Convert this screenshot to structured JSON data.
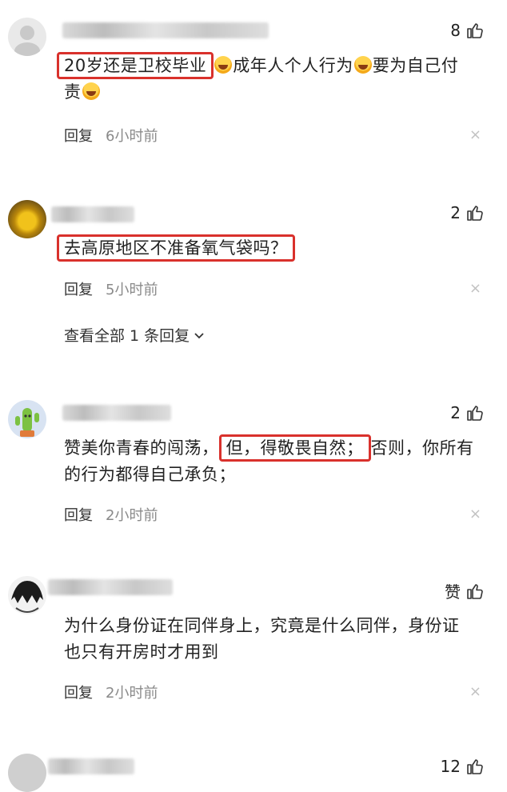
{
  "comments": [
    {
      "likes": "8",
      "segments": {
        "highlight": "20岁还是卫校毕业",
        "rest1": "成年人个人行为",
        "rest2": "要为自己付",
        "rest3": "责"
      },
      "reply": "回复",
      "time": "6小时前",
      "close": "×"
    },
    {
      "likes": "2",
      "segments": {
        "highlight": "去高原地区不准备氧气袋吗？"
      },
      "reply": "回复",
      "time": "5小时前",
      "close": "×",
      "view_all": "查看全部 1 条回复"
    },
    {
      "likes": "2",
      "segments": {
        "before": "赞美你青春的闯荡，",
        "highlight": "但，得敬畏自然；",
        "after": "否则，你所有",
        "line2": "的行为都得自己承负；"
      },
      "reply": "回复",
      "time": "2小时前",
      "close": "×"
    },
    {
      "likes": "赞",
      "segments": {
        "line1": "为什么身份证在同伴身上，究竟是什么同伴，身份证",
        "line2": "也只有开房时才用到"
      },
      "reply": "回复",
      "time": "2小时前",
      "close": "×"
    },
    {
      "likes": "12"
    }
  ],
  "icons": {
    "like": "thumbs-up-icon",
    "close": "close-icon",
    "emoji": "laughing-crying-emoji-icon",
    "chevron": "chevron-down-icon"
  },
  "colors": {
    "highlight_border": "#d9312c",
    "time_text": "#8a8a8a"
  }
}
